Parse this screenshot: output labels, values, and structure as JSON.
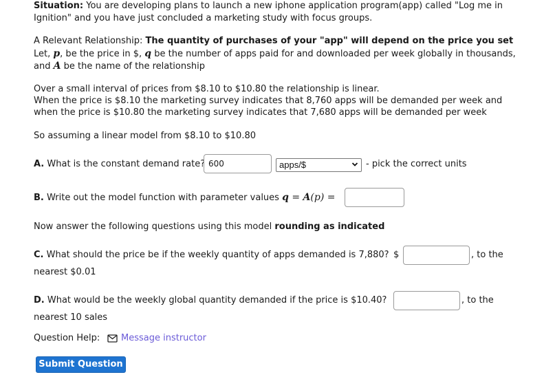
{
  "situation": {
    "label": "Situation:",
    "line1": " You are developing plans to launch a new iphone application program(app) called \"Log me in",
    "line2": "Ignition\" and you have just concluded a marketing study with focus groups."
  },
  "relationship": {
    "label": "A Relevant Relationship: ",
    "bold_text": "The quantity of purchases of your \"app\" will depend on the price you set",
    "let_prefix": "Let, ",
    "var_p": "p",
    "p_desc": ", be the price in $, ",
    "var_q": "q",
    "q_desc": " be the number of apps paid for and downloaded per week globally in thousands,",
    "and_prefix": "and ",
    "var_A": "A",
    "A_desc": " be the name of the relationship"
  },
  "context": {
    "line1": "Over a small interval of prices from $8.10 to $10.80 the relationship is linear.",
    "line2": "When the price is $8.10 the marketing survey indicates that 8,760 apps will be demanded per week and",
    "line3": "when the price is $10.80 the marketing survey indicates that 7,680 apps will be demanded per week",
    "line4": "So assuming a linear model from $8.10 to $10.80"
  },
  "questionA": {
    "label": "A.",
    "text": " What is the constant demand rate?",
    "input_value": "600",
    "unit_selected": "apps/$",
    "hint": "- pick the correct units"
  },
  "questionB": {
    "label": "B.",
    "text": " Write out the model function with parameter values ",
    "formula_q": "q",
    "formula_eq": " = ",
    "formula_A": "A",
    "formula_p": "(p)",
    "formula_eq2": " =",
    "input_value": ""
  },
  "instructions": {
    "text": "Now answer the following questions using this model ",
    "bold": "rounding as indicated"
  },
  "questionC": {
    "label": "C.",
    "text": " What should the price be if the weekly quantity of apps demanded is 7,880?",
    "currency": "$",
    "input_value": "",
    "suffix": ", to the",
    "line2": "nearest $0.01"
  },
  "questionD": {
    "label": "D.",
    "text": " What would be the weekly global quantity demanded if the price is $10.40?",
    "input_value": "",
    "suffix": ", to the",
    "line2": "nearest 10 sales"
  },
  "help": {
    "label": "Question Help:",
    "icon": "mail-icon",
    "link": "Message instructor"
  },
  "submit": {
    "label": "Submit Question"
  }
}
